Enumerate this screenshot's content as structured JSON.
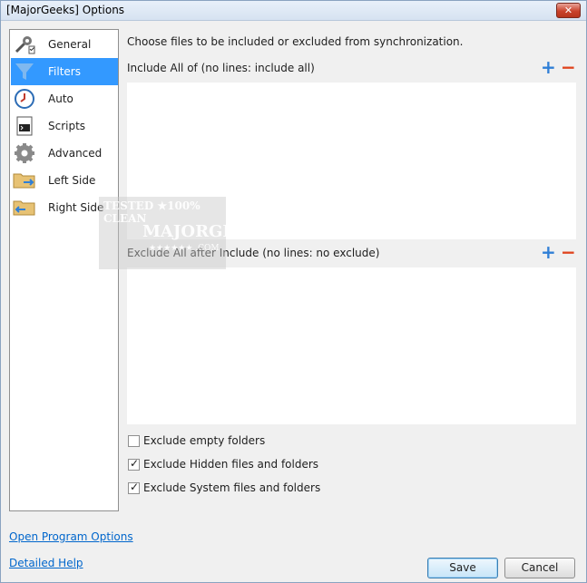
{
  "window": {
    "title": "[MajorGeeks] Options",
    "close_label": "✕"
  },
  "sidebar": {
    "items": [
      {
        "label": "General",
        "icon": "wrench-icon"
      },
      {
        "label": "Filters",
        "icon": "funnel-icon",
        "selected": true
      },
      {
        "label": "Auto",
        "icon": "clock-icon"
      },
      {
        "label": "Scripts",
        "icon": "terminal-icon"
      },
      {
        "label": "Advanced",
        "icon": "gear-icon"
      },
      {
        "label": "Left Side",
        "icon": "folder-right-arrow-icon"
      },
      {
        "label": "Right Side",
        "icon": "folder-left-arrow-icon"
      }
    ]
  },
  "main": {
    "description": "Choose files to be included or excluded from synchronization.",
    "include_label": "Include All of (no lines: include all)",
    "exclude_label": "Exclude All after Include (no lines: no exclude)",
    "plus": "+",
    "minus": "−"
  },
  "options": {
    "exclude_empty": {
      "label": "Exclude empty folders",
      "checked": false
    },
    "exclude_hidden": {
      "label": "Exclude Hidden files and folders",
      "checked": true
    },
    "exclude_system": {
      "label": "Exclude System files and folders",
      "checked": true
    }
  },
  "links": {
    "program_options": "Open Program Options",
    "detailed_help": "Detailed Help"
  },
  "buttons": {
    "save": "Save",
    "cancel": "Cancel"
  },
  "watermark": {
    "line1": "TESTED ★100% CLEAN",
    "line2": "MAJORGEEKS",
    "line3": "★★★★★★ .COM"
  },
  "colors": {
    "accent": "#3399ff",
    "plus": "#2f7fd6",
    "minus": "#e0431d",
    "link": "#0066cc"
  }
}
